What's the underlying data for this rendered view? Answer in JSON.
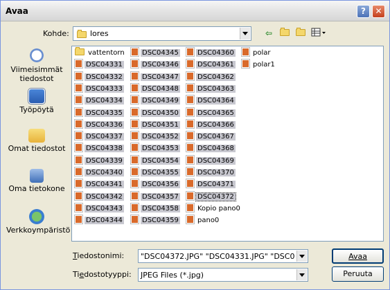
{
  "window": {
    "title": "Avaa",
    "help_label": "?",
    "close_label": "✕"
  },
  "lookin": {
    "label": "Kohde:",
    "value": "lores"
  },
  "toolbar": {
    "back_icon": "⇦",
    "up_icon": "folder-up-icon",
    "newfolder_icon": "new-folder-icon",
    "views_icon": "views-menu-icon"
  },
  "places": [
    {
      "label": "Viimeisimmät tiedostot",
      "icon": "recent-icon"
    },
    {
      "label": "Työpöytä",
      "icon": "desktop-icon"
    },
    {
      "label": "Omat tiedostot",
      "icon": "my-documents-icon"
    },
    {
      "label": "Oma tietokone",
      "icon": "my-computer-icon"
    },
    {
      "label": "Verkkoympäristö",
      "icon": "network-icon"
    }
  ],
  "files": {
    "col1": [
      "vattentorn",
      "DSC04331",
      "DSC04332",
      "DSC04333",
      "DSC04334",
      "DSC04335",
      "DSC04336",
      "DSC04337",
      "DSC04338",
      "DSC04339",
      "DSC04340",
      "DSC04341",
      "DSC04342",
      "DSC04343",
      "DSC04344"
    ],
    "col2": [
      "DSC04345",
      "DSC04346",
      "DSC04347",
      "DSC04348",
      "DSC04349",
      "DSC04350",
      "DSC04351",
      "DSC04352",
      "DSC04353",
      "DSC04354",
      "DSC04355",
      "DSC04356",
      "DSC04357",
      "DSC04358",
      "DSC04359"
    ],
    "col3": [
      "DSC04360",
      "DSC04361",
      "DSC04362",
      "DSC04363",
      "DSC04364",
      "DSC04365",
      "DSC04366",
      "DSC04367",
      "DSC04368",
      "DSC04369",
      "DSC04370",
      "DSC04371",
      "DSC04372",
      "Kopio pano0",
      "pano0"
    ],
    "col4": [
      "polar",
      "polar1"
    ]
  },
  "filename": {
    "label": "Tiedostonimi:",
    "value": "\"DSC04372.JPG\" \"DSC04331.JPG\" \"DSC043"
  },
  "filetype": {
    "label": "Tiedostotyyppi:",
    "value": "JPEG Files (*.jpg)"
  },
  "buttons": {
    "open": "Avaa",
    "cancel": "Peruuta"
  },
  "colors": {
    "selection": "#c8c8d0",
    "dialog_bg": "#ece9d8",
    "border": "#7f9db9"
  }
}
